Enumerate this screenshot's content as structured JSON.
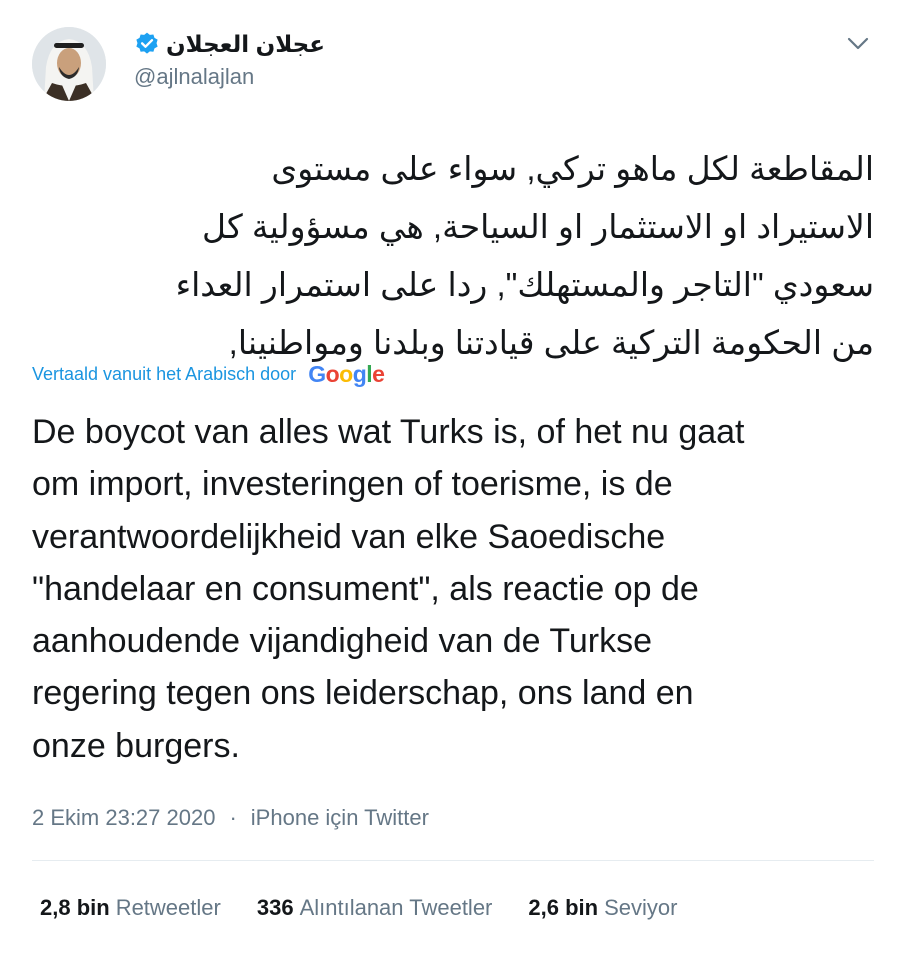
{
  "author": {
    "display_name": "عجلان العجلان",
    "handle": "@ajlnalajlan",
    "verified": true,
    "avatar_icon": "profile-photo"
  },
  "tweet": {
    "arabic_lines": [
      "المقاطعة لكل ماهو تركي, سواء على مستوى",
      "الاستيراد او الاستثمار او السياحة, هي مسؤولية كل",
      "سعودي \"التاجر والمستهلك\", ردا على استمرار العداء",
      "من الحكومة التركية على قيادتنا وبلدنا ومواطنينا,"
    ],
    "translate_label": "Vertaald vanuit het Arabisch door",
    "translate_provider": "Google",
    "translated_lines": [
      "De boycot van alles wat Turks is, of het nu gaat",
      "om import, investeringen of toerisme, is de",
      "verantwoordelijkheid van elke Saoedische",
      "\"handelaar en consument\", als reactie op de",
      "aanhoudende vijandigheid van de Turkse",
      "regering tegen ons leiderschap, ons land en",
      "onze burgers."
    ]
  },
  "meta": {
    "timestamp": "2 Ekim 23:27 2020",
    "separator": "·",
    "source": "iPhone için Twitter"
  },
  "stats": {
    "retweets_count": "2,8 bin",
    "retweets_label": "Retweetler",
    "quotes_count": "336",
    "quotes_label": "Alıntılanan Tweetler",
    "likes_count": "2,6 bin",
    "likes_label": "Seviyor"
  },
  "colors": {
    "link": "#1b95e0",
    "secondary_text": "#657786",
    "primary_text": "#14171a",
    "verified_badge": "#1da1f2",
    "divider": "#e6ecf0"
  }
}
